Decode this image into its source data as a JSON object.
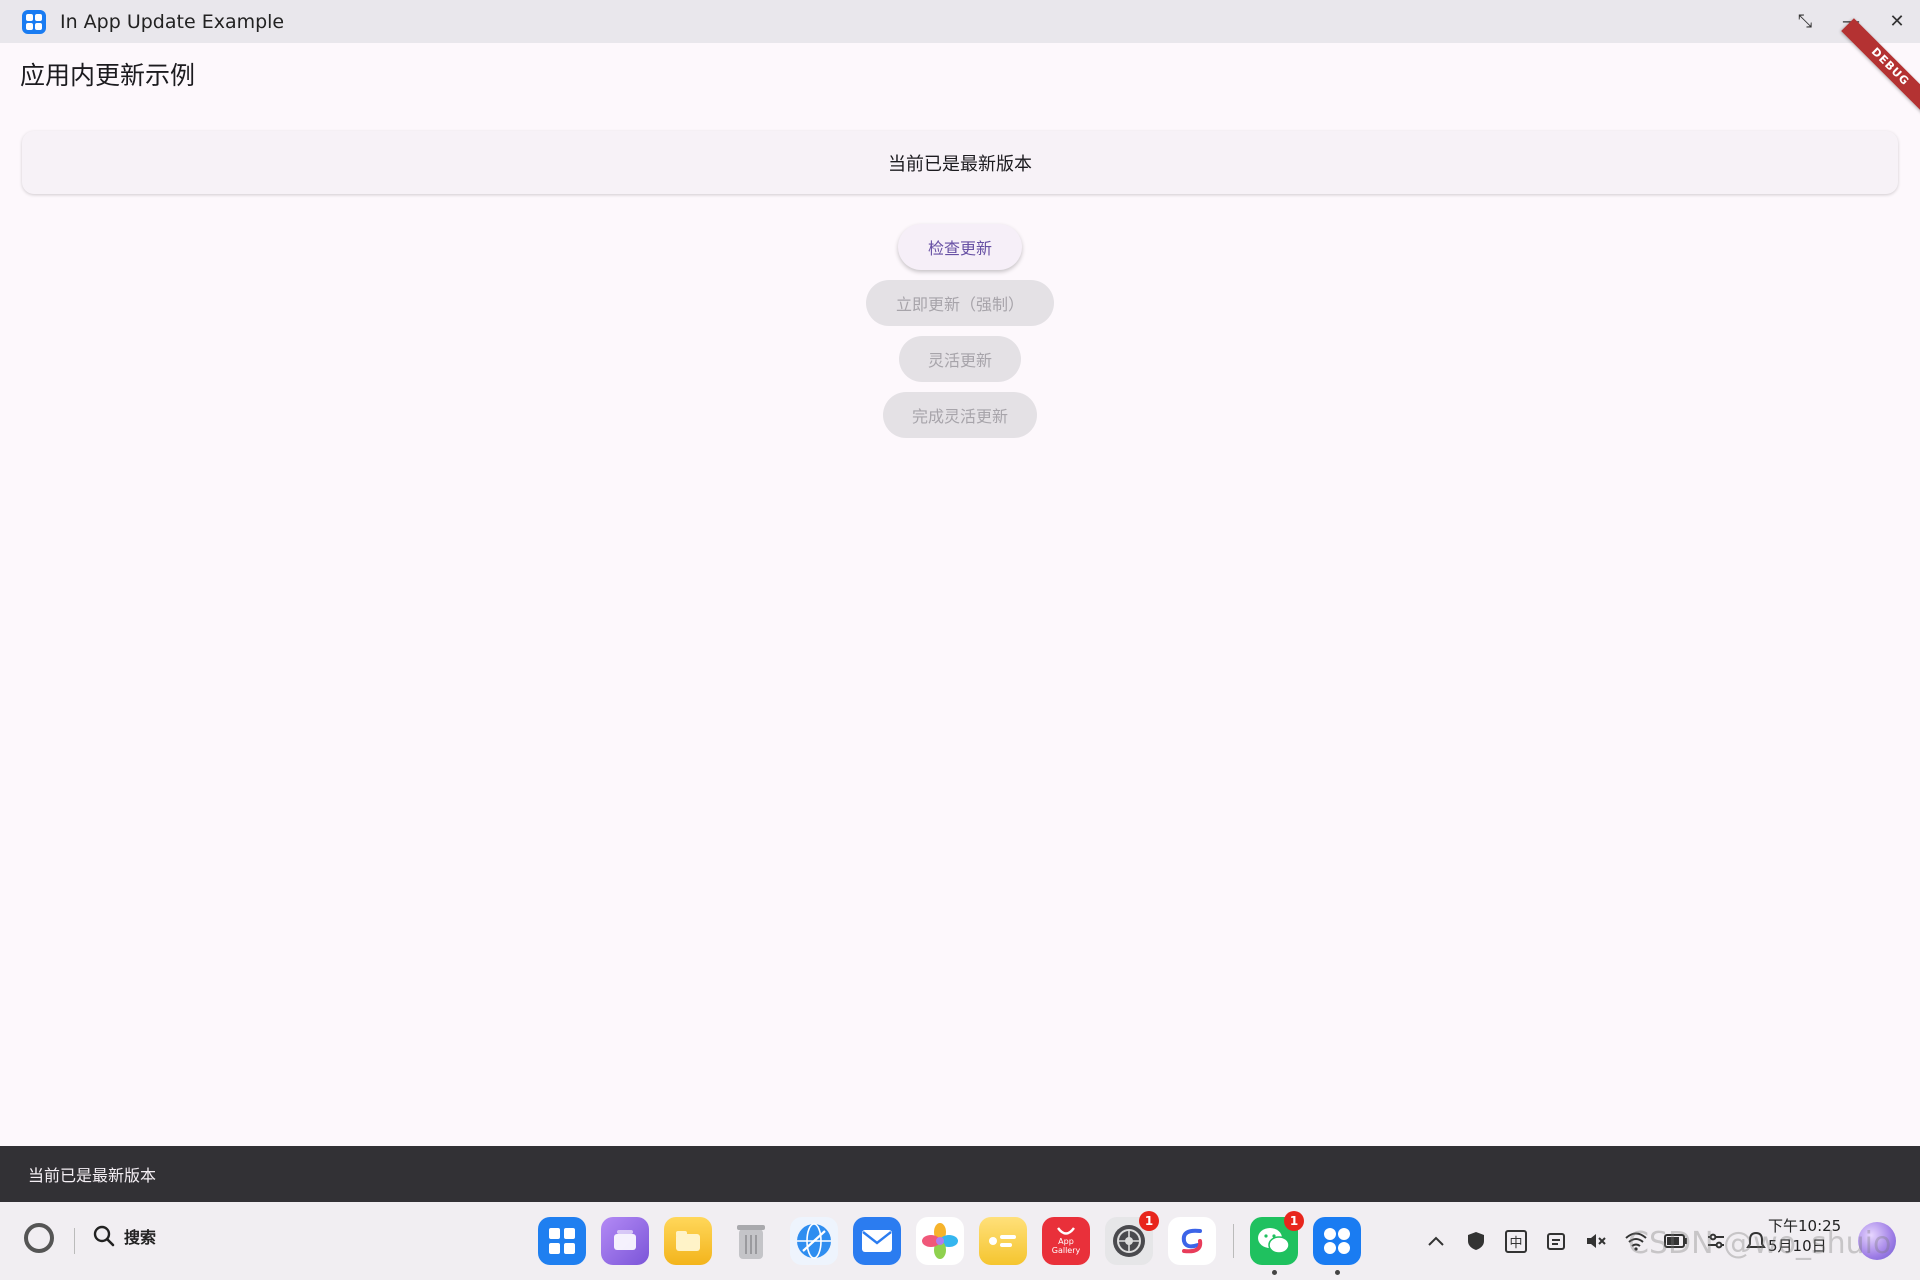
{
  "window": {
    "title": "In App Update Example",
    "restore_glyph": "⤡",
    "minimize_glyph": "—",
    "close_glyph": "✕"
  },
  "debug_banner": "DEBUG",
  "app_bar": {
    "title": "应用内更新示例"
  },
  "status_card": {
    "text": "当前已是最新版本"
  },
  "buttons": {
    "check_update": "检查更新",
    "immediate_update": "立即更新（强制）",
    "flexible_update": "灵活更新",
    "complete_flexible_update": "完成灵活更新"
  },
  "snackbar": {
    "text": "当前已是最新版本"
  },
  "taskbar": {
    "search_label": "搜索",
    "dock": [
      {
        "name": "launcher-icon",
        "color": "#1f7ff0"
      },
      {
        "name": "multitask-icon",
        "color": "#9b6fe8"
      },
      {
        "name": "files-icon",
        "color": "#f6c232"
      },
      {
        "name": "trash-icon",
        "color": "#c9c9cc"
      },
      {
        "name": "browser-icon",
        "color": "#2f8ef0"
      },
      {
        "name": "mail-icon",
        "color": "#2b7cf0"
      },
      {
        "name": "gallery-icon",
        "color": "#f59f2a"
      },
      {
        "name": "notes-icon",
        "color": "#f7cf3c"
      },
      {
        "name": "app-gallery-icon",
        "color": "#e9303a",
        "label": "App Gallery"
      },
      {
        "name": "settings-icon",
        "color": "#4a4a4e",
        "badge": "1"
      },
      {
        "name": "assistant-icon",
        "color": "#ffffff"
      },
      {
        "name": "wechat-icon",
        "color": "#1fc15f",
        "badge": "1"
      },
      {
        "name": "running-app-icon",
        "color": "#1a7cf2"
      }
    ],
    "clock_time": "下午10:25",
    "clock_date": "5月10日",
    "ime_label": "中"
  },
  "watermark": "CSDN @wo_shuio"
}
